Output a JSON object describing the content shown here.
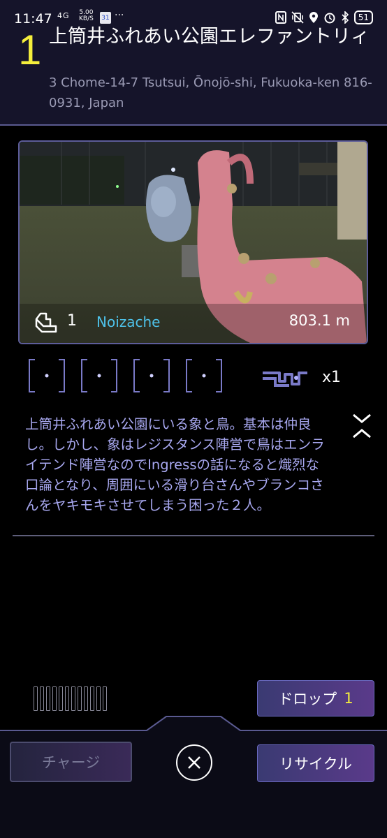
{
  "status_bar": {
    "time": "11:47",
    "network": "4G",
    "speed_value": "5.00",
    "speed_unit": "KB/S",
    "calendar_day": "31",
    "more": "···",
    "battery": "51"
  },
  "portal": {
    "level": "1",
    "name": "上筒井ふれあい公園エレファントリィ",
    "address": "3 Chome-14-7 Tsutsui, Ōnojō-shi, Fukuoka-ken 816-0931, Japan",
    "key_count": "1",
    "owner": "Noizache",
    "distance": "803.1 m",
    "mod_count": "x1",
    "description": "上筒井ふれあい公園にいる象と鳥。基本は仲良し。しかし、象はレジスタンス陣営で鳥はエンライテンド陣営なのでIngressの話になると熾烈な口論となり、周囲にいる滑り台さんやブランコさんをヤキモキさせてしまう困った２人。"
  },
  "actions": {
    "drop_label": "ドロップ",
    "drop_count": "1",
    "charge_label": "チャージ",
    "recycle_label": "リサイクル"
  },
  "colors": {
    "level": "#f5ef3c",
    "owner": "#4ec2ea",
    "description": "#a8a8f0",
    "frame": "#5d5d9a"
  }
}
